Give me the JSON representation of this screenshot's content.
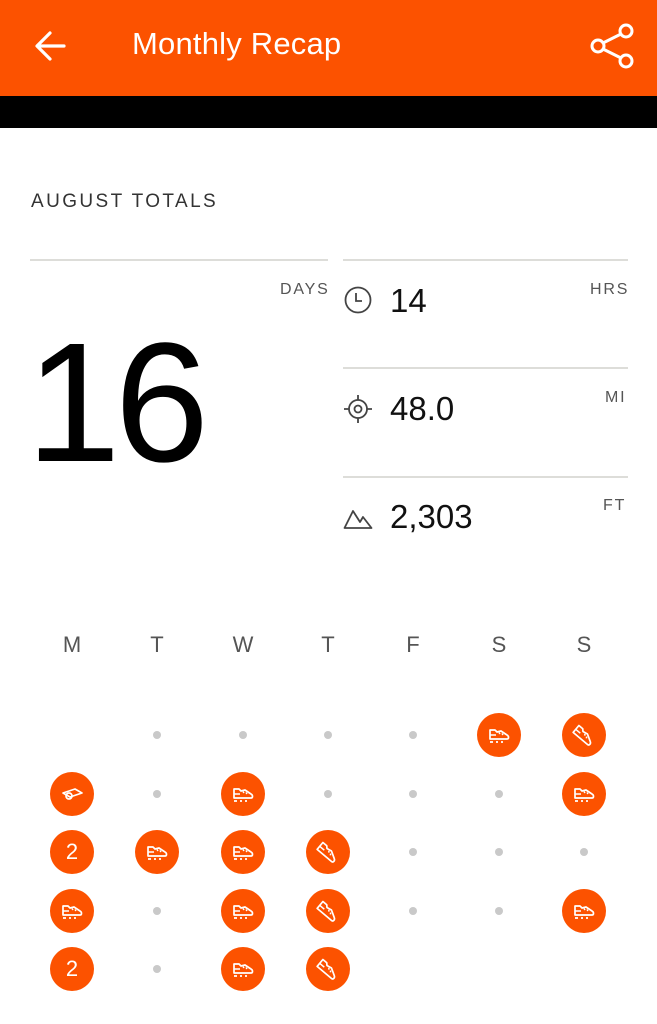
{
  "header": {
    "title": "Monthly Recap",
    "back_icon": "arrow-left-icon",
    "share_icon": "share-icon",
    "bg_color": "#fc5200"
  },
  "totals": {
    "section_title": "AUGUST TOTALS",
    "days": {
      "value": "16",
      "unit": "DAYS"
    },
    "time": {
      "icon": "clock-icon",
      "value": "14",
      "unit": "HRS"
    },
    "distance": {
      "icon": "crosshair-icon",
      "value": "48.0",
      "unit": "MI"
    },
    "elevation": {
      "icon": "mountain-icon",
      "value": "2,303",
      "unit": "FT"
    }
  },
  "calendar": {
    "weekdays": [
      "M",
      "T",
      "W",
      "T",
      "F",
      "S",
      "S"
    ],
    "accent_color": "#fc5200",
    "rows": [
      [
        {
          "type": "empty"
        },
        {
          "type": "dot"
        },
        {
          "type": "dot"
        },
        {
          "type": "dot"
        },
        {
          "type": "dot"
        },
        {
          "type": "walk"
        },
        {
          "type": "run"
        }
      ],
      [
        {
          "type": "yoga"
        },
        {
          "type": "dot"
        },
        {
          "type": "walk"
        },
        {
          "type": "dot"
        },
        {
          "type": "dot"
        },
        {
          "type": "dot"
        },
        {
          "type": "walk"
        }
      ],
      [
        {
          "type": "count",
          "label": "2"
        },
        {
          "type": "walk"
        },
        {
          "type": "walk"
        },
        {
          "type": "run"
        },
        {
          "type": "dot"
        },
        {
          "type": "dot"
        },
        {
          "type": "dot"
        }
      ],
      [
        {
          "type": "walk"
        },
        {
          "type": "dot"
        },
        {
          "type": "walk"
        },
        {
          "type": "run"
        },
        {
          "type": "dot"
        },
        {
          "type": "dot"
        },
        {
          "type": "walk"
        }
      ],
      [
        {
          "type": "count",
          "label": "2"
        },
        {
          "type": "dot"
        },
        {
          "type": "walk"
        },
        {
          "type": "run"
        },
        {
          "type": "empty"
        },
        {
          "type": "empty"
        },
        {
          "type": "empty"
        }
      ]
    ]
  }
}
